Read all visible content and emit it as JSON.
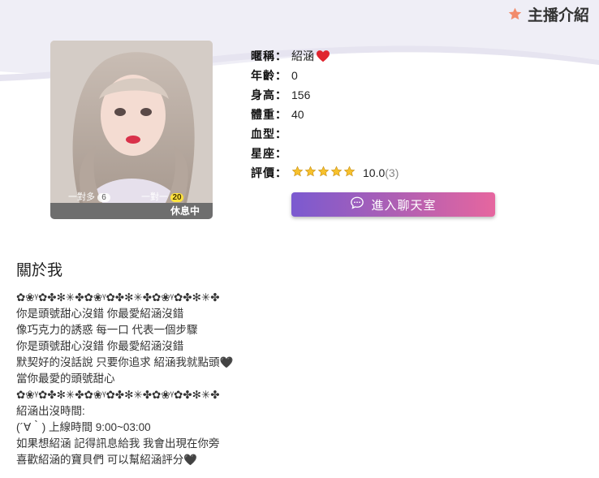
{
  "header": {
    "title": "主播介紹",
    "icon": "star-icon",
    "icon_color": "#f28b6b"
  },
  "photo": {
    "stat_left_label": "一對多",
    "stat_left_count": "6",
    "stat_right_label": "一對一",
    "stat_right_count": "20",
    "status": "休息中"
  },
  "info": {
    "nickname_label": "暱稱：",
    "nickname_value": "紹涵",
    "age_label": "年齡：",
    "age_value": "0",
    "height_label": "身高：",
    "height_value": "156",
    "weight_label": "體重：",
    "weight_value": "40",
    "blood_label": "血型：",
    "blood_value": "",
    "star_sign_label": "星座：",
    "star_sign_value": "",
    "rating_label": "評價：",
    "rating_stars": 5,
    "rating_score": "10.0",
    "rating_count": "(3)"
  },
  "chat_button": {
    "label": "進入聊天室",
    "icon": "chat-bubble-icon"
  },
  "about": {
    "title": "關於我",
    "lines": [
      "✿❀ᵞ✿✤✻✳✤✿❀ᵞ✿✤✻✳✤✿❀ᵞ✿✤✻✳✤",
      "你是頭號甜心沒錯 你最愛紹涵沒錯",
      "像巧克力的誘惑 每一口 代表一個步驟",
      "你是頭號甜心沒錯 你最愛紹涵沒錯",
      "默契好的沒話說 只要你追求 紹涵我就點頭🖤",
      "當你最愛的頭號甜心",
      "✿❀ᵞ✿✤✻✳✤✿❀ᵞ✿✤✻✳✤✿❀ᵞ✿✤✻✳✤",
      "紹涵出沒時間:",
      "(´∀｀) 上線時間 9:00~03:00",
      "如果想紹涵 記得訊息給我 我會出現在你旁",
      "喜歡紹涵的寶貝們 可以幫紹涵評分🖤"
    ]
  },
  "colors": {
    "accent_gradient_start": "#7b5ad0",
    "accent_gradient_end": "#e6669f",
    "badge_yellow": "#ffe33d",
    "status_bar": "#6e6e6e"
  }
}
